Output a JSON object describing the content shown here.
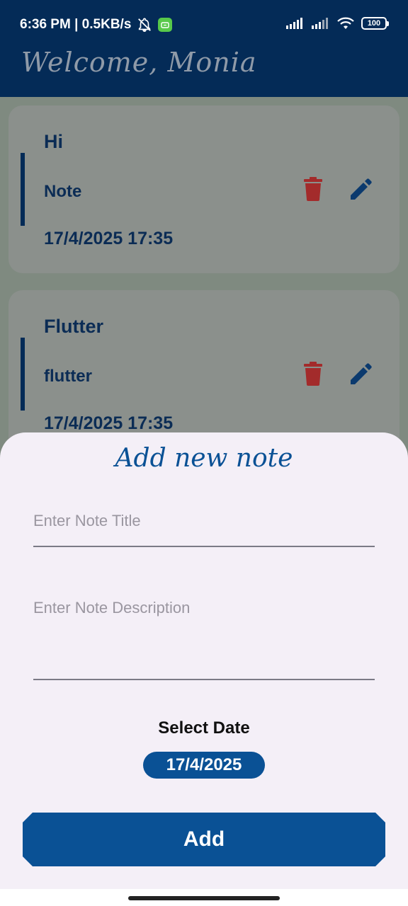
{
  "status_bar": {
    "time_speed": "6:36 PM | 0.5KB/s",
    "battery": "100"
  },
  "app_bar": {
    "welcome": "Welcome, Monia"
  },
  "notes": [
    {
      "title": "Hi",
      "description": "Note",
      "date": "17/4/2025 17:35"
    },
    {
      "title": "Flutter",
      "description": "flutter",
      "date": "17/4/2025 17:35"
    }
  ],
  "sheet": {
    "title": "Add new note",
    "title_placeholder": "Enter Note Title",
    "description_placeholder": "Enter Note Description",
    "select_date_label": "Select Date",
    "date_value": "17/4/2025",
    "add_label": "Add"
  },
  "colors": {
    "primary": "#0a5195",
    "dark_navy": "#042b57",
    "delete_red": "#a32b2b",
    "sheet_bg": "#f4eff7"
  },
  "icons": {
    "delete": "trash-icon",
    "edit": "pencil-icon"
  }
}
